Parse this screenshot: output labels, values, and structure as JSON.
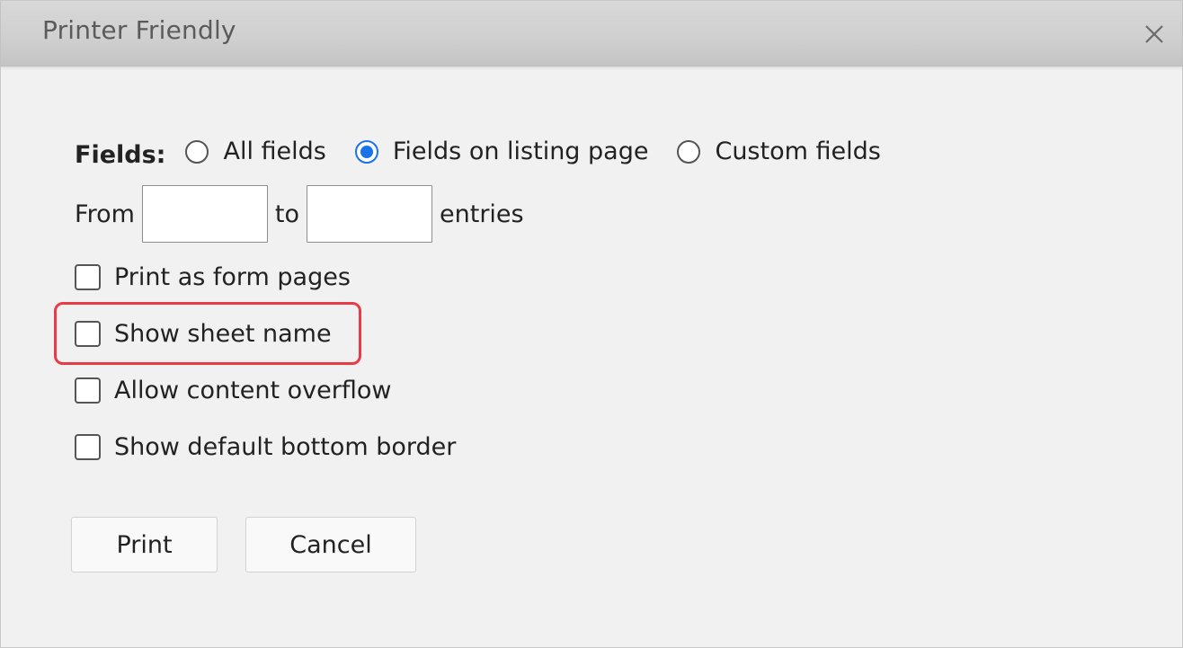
{
  "dialog": {
    "title": "Printer Friendly",
    "close_icon": "close-icon"
  },
  "fields": {
    "label": "Fields:",
    "options": [
      {
        "label": "All fields",
        "checked": false
      },
      {
        "label": "Fields on listing page",
        "checked": true
      },
      {
        "label": "Custom fields",
        "checked": false
      }
    ]
  },
  "range": {
    "from_label": "From",
    "from_value": "",
    "to_label": "to",
    "to_value": "",
    "suffix": "entries"
  },
  "checkboxes": [
    {
      "label": "Print as form pages",
      "checked": false
    },
    {
      "label": "Show sheet name",
      "checked": false
    },
    {
      "label": "Allow content overflow",
      "checked": false
    },
    {
      "label": "Show default bottom border",
      "checked": false
    }
  ],
  "buttons": {
    "print": "Print",
    "cancel": "Cancel"
  },
  "colors": {
    "accent": "#1a73e8",
    "highlight": "#ea3a45"
  }
}
